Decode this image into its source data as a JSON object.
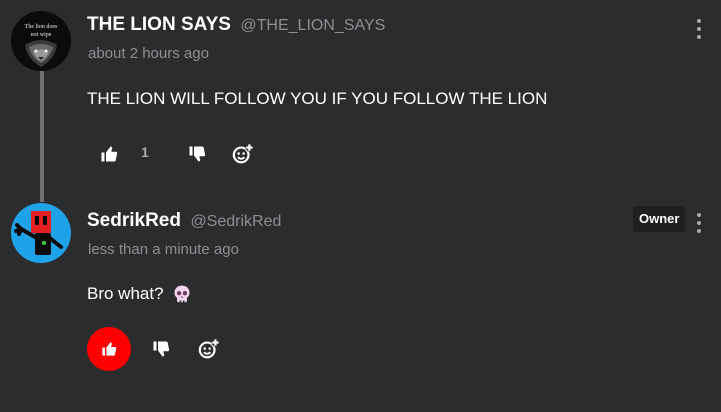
{
  "comments": [
    {
      "author_name": "THE LION SAYS",
      "author_handle": "@THE_LION_SAYS",
      "timestamp": "about 2 hours ago",
      "text": "THE LION WILL FOLLOW YOU IF YOU FOLLOW THE LION",
      "likes": "1",
      "liked": false,
      "avatar_text": [
        "The lion does",
        "not wipe"
      ]
    },
    {
      "author_name": "SedrikRed",
      "author_handle": "@SedrikRed",
      "timestamp": "less than a minute ago",
      "text": "Bro what?",
      "badge": "Owner",
      "liked": true,
      "emoji_icon": "skull-icon"
    }
  ],
  "colors": {
    "background": "#2b2c2e",
    "liked": "#ff0000",
    "muted": "#8e8f92",
    "icon": "#ffffff",
    "avatar2_bg": "#1ea2e8"
  }
}
